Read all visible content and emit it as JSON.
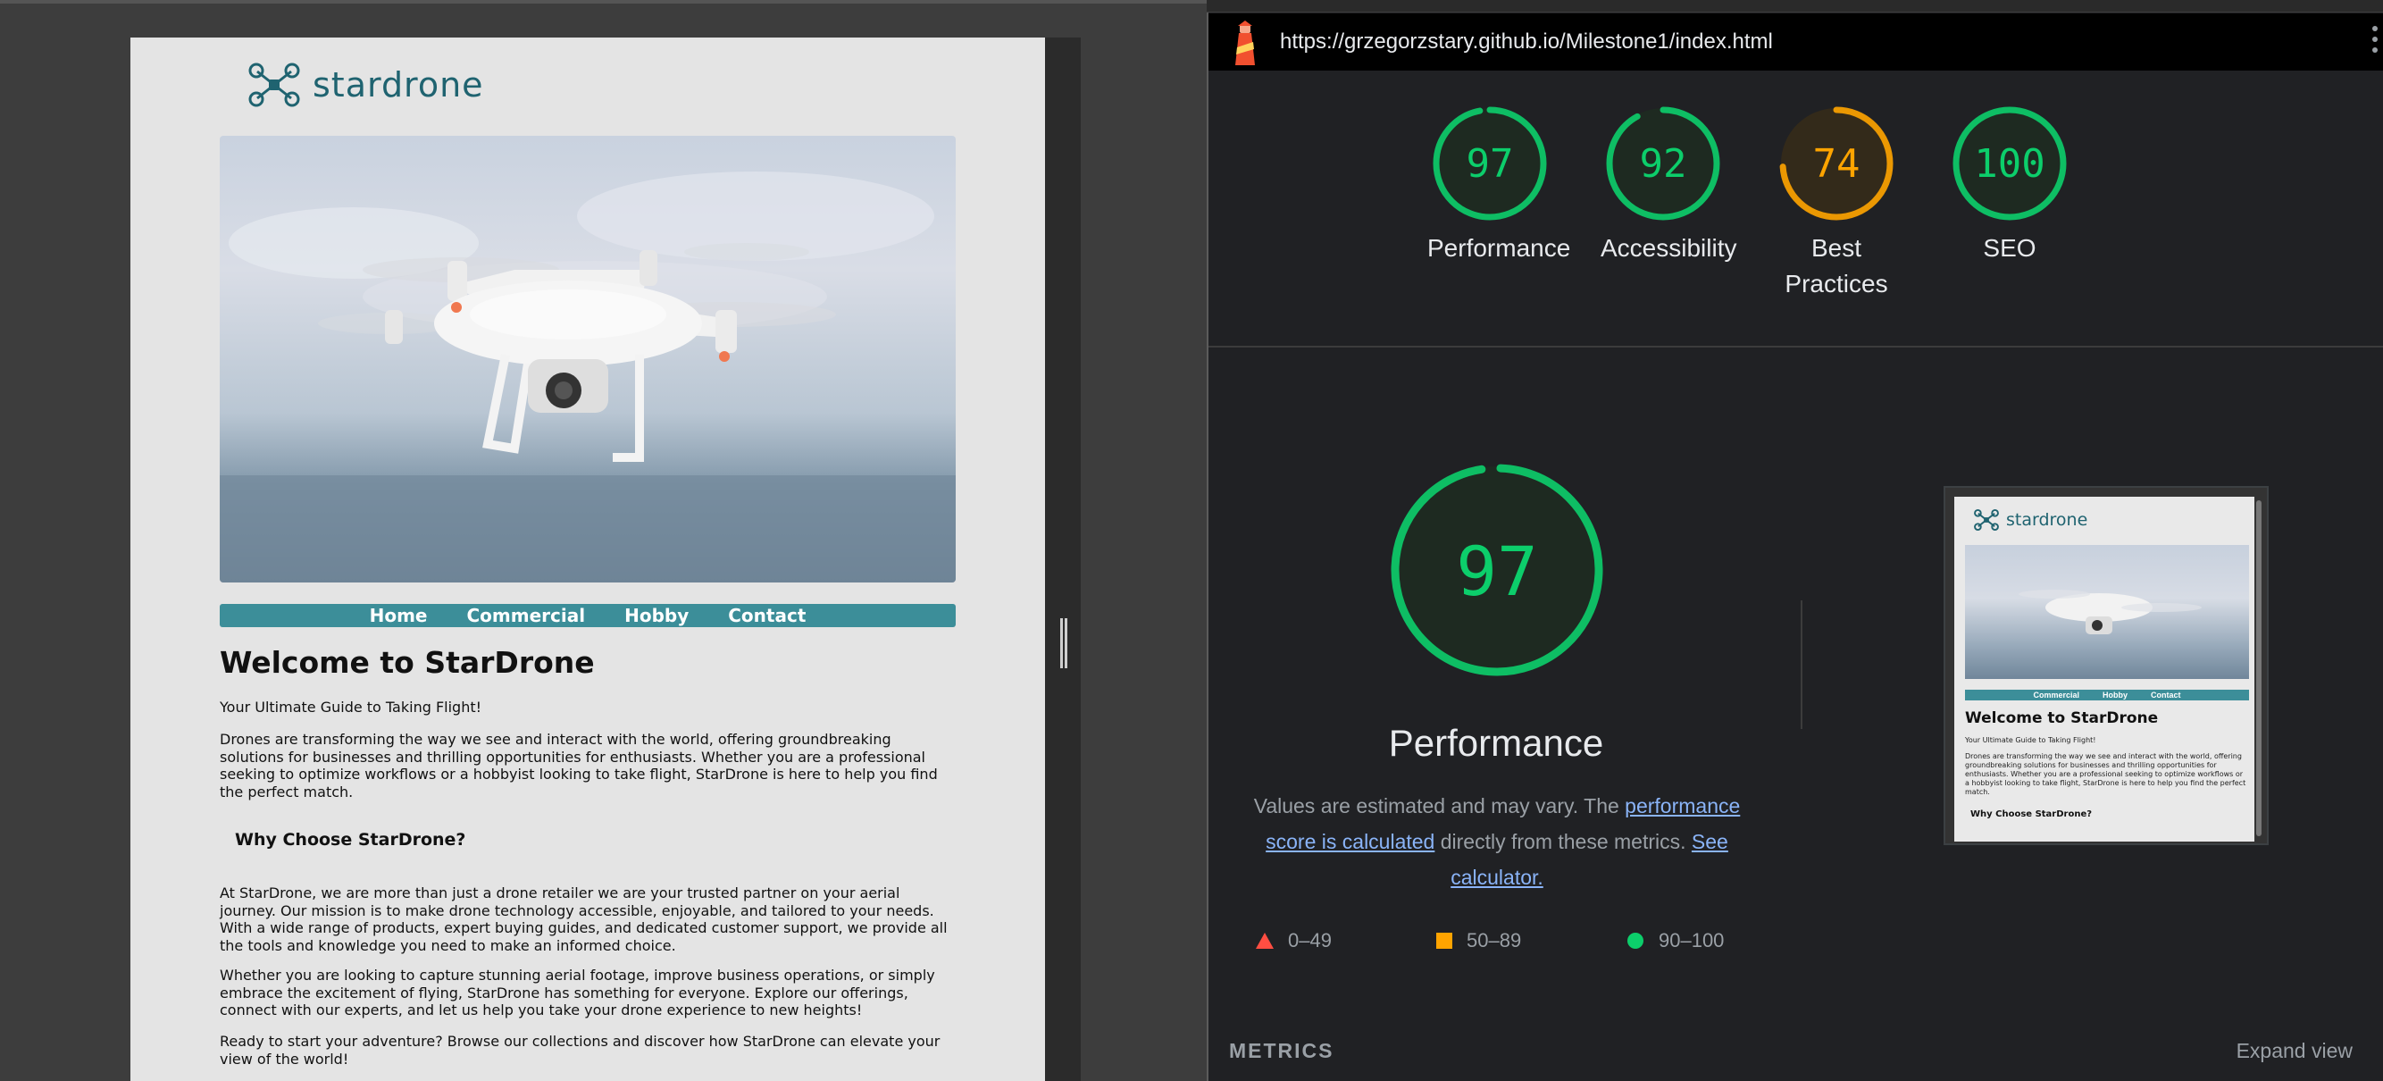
{
  "site": {
    "logo_text": "stardrone",
    "nav": [
      "Home",
      "Commercial",
      "Hobby",
      "Contact"
    ],
    "heading": "Welcome to StarDrone",
    "tagline": "Your Ultimate Guide to Taking Flight!",
    "intro": "Drones are transforming the way we see and interact with the world, offering groundbreaking solutions for businesses and thrilling opportunities for enthusiasts. Whether you are a professional seeking to optimize workflows or a hobbyist looking to take flight, StarDrone is here to help you find the perfect match.",
    "why_heading": "Why Choose StarDrone?",
    "why_p1": "At StarDrone, we are more than just a drone retailer we are your trusted partner on your aerial journey. Our mission is to make drone technology accessible, enjoyable, and tailored to your needs. With a wide range of products, expert buying guides, and dedicated customer support, we provide all the tools and knowledge you need to make an informed choice.",
    "why_p2": "Whether you are looking to capture stunning aerial footage, improve business operations, or simply embrace the excitement of flying, StarDrone has something for everyone. Explore our offerings, connect with our experts, and let us help you take your drone experience to new heights!",
    "why_p3": "Ready to start your adventure? Browse our collections and discover how StarDrone can elevate your view of the world!"
  },
  "lighthouse": {
    "url": "https://grzegorzstary.github.io/Milestone1/index.html",
    "scores": [
      {
        "label": "Performance",
        "value": 97,
        "color": "#0cce6b"
      },
      {
        "label": "Accessibility",
        "value": 92,
        "color": "#0cce6b"
      },
      {
        "label": "Best Practices",
        "value": 74,
        "color": "#ffa400"
      },
      {
        "label": "SEO",
        "value": 100,
        "color": "#0cce6b"
      }
    ],
    "main_score": 97,
    "main_label": "Performance",
    "desc_prefix": "Values are estimated and may vary. The ",
    "desc_link1": "performance score is calculated",
    "desc_middle": " directly from these metrics. ",
    "desc_link2": "See calculator.",
    "legend": [
      {
        "range": "0–49",
        "shape": "triangle",
        "color": "#ff4e42"
      },
      {
        "range": "50–89",
        "shape": "square",
        "color": "#ffa400"
      },
      {
        "range": "90–100",
        "shape": "circle",
        "color": "#0cce6b"
      }
    ],
    "metrics_label": "METRICS",
    "expand_label": "Expand view"
  },
  "thumbnail": {
    "logo_text": "stardrone",
    "nav": [
      "Commercial",
      "Hobby",
      "Contact"
    ],
    "heading": "Welcome to StarDrone",
    "tagline": "Your Ultimate Guide to Taking Flight!",
    "intro": "Drones are transforming the way we see and interact with the world, offering groundbreaking solutions for businesses and thrilling opportunities for enthusiasts. Whether you are a professional seeking to optimize workflows or a hobbyist looking to take flight, StarDrone is here to help you find the perfect match.",
    "why_heading": "Why Choose StarDrone?"
  }
}
